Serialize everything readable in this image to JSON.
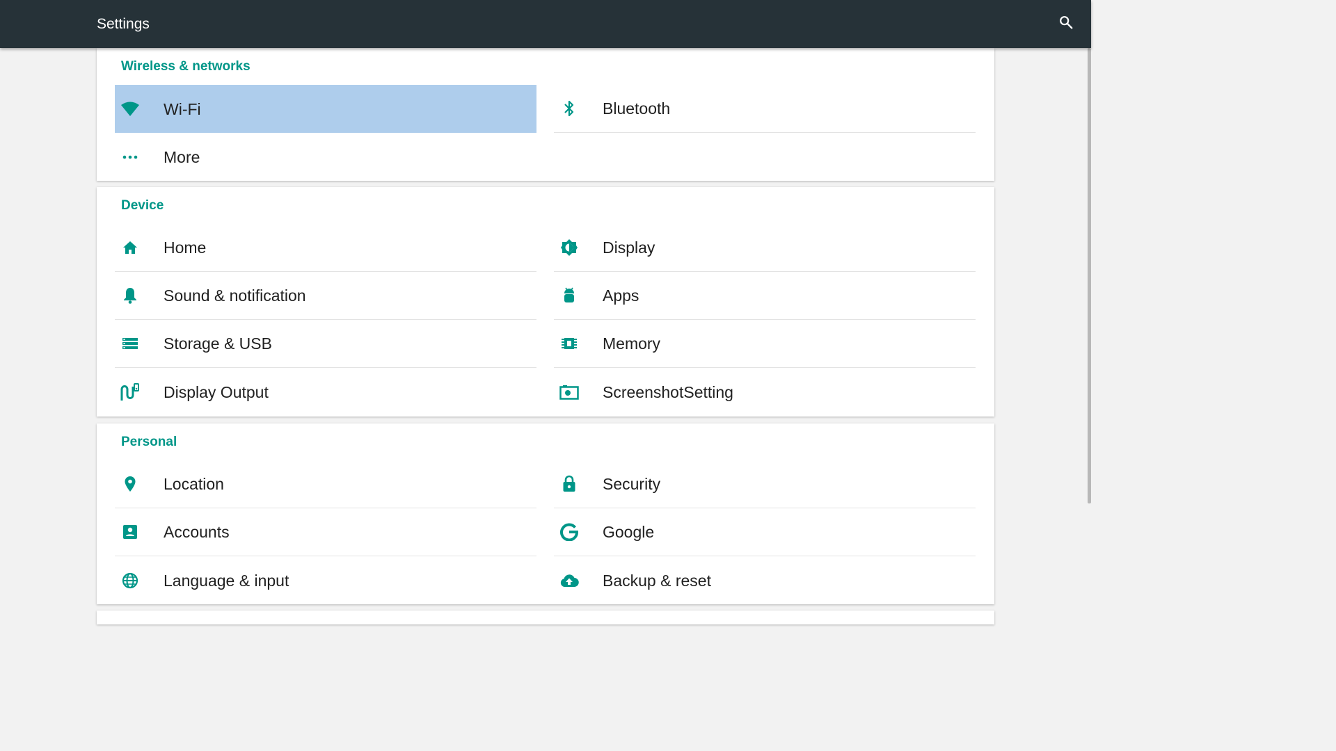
{
  "toolbar": {
    "title": "Settings",
    "search_icon": "search-icon"
  },
  "colors": {
    "toolbar_bg": "#263238",
    "accent": "#009688",
    "selected_bg": "#aecdec",
    "page_bg": "#f2f2f2"
  },
  "sections": {
    "wireless": {
      "title": "Wireless & networks",
      "items": [
        {
          "label": "Wi-Fi",
          "icon": "wifi-icon",
          "selected": true
        },
        {
          "label": "Bluetooth",
          "icon": "bluetooth-icon"
        },
        {
          "label": "More",
          "icon": "more-icon"
        }
      ]
    },
    "device": {
      "title": "Device",
      "items": [
        {
          "label": "Home",
          "icon": "home-icon"
        },
        {
          "label": "Display",
          "icon": "brightness-icon"
        },
        {
          "label": "Sound & notification",
          "icon": "bell-icon"
        },
        {
          "label": "Apps",
          "icon": "android-icon"
        },
        {
          "label": "Storage & USB",
          "icon": "storage-icon"
        },
        {
          "label": "Memory",
          "icon": "memory-chip-icon"
        },
        {
          "label": "Display Output",
          "icon": "display-output-icon"
        },
        {
          "label": "ScreenshotSetting",
          "icon": "screenshot-icon"
        }
      ]
    },
    "personal": {
      "title": "Personal",
      "items": [
        {
          "label": "Location",
          "icon": "location-pin-icon"
        },
        {
          "label": "Security",
          "icon": "lock-icon"
        },
        {
          "label": "Accounts",
          "icon": "account-box-icon"
        },
        {
          "label": "Google",
          "icon": "google-icon"
        },
        {
          "label": "Language & input",
          "icon": "globe-icon"
        },
        {
          "label": "Backup & reset",
          "icon": "cloud-upload-icon"
        }
      ]
    }
  }
}
